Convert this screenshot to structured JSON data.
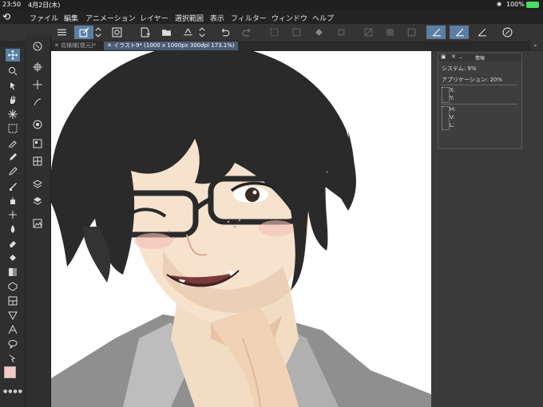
{
  "status": {
    "time": "23:50",
    "date": "4月2日(木)",
    "battery": "100%"
  },
  "menu": {
    "items": [
      "ファイル",
      "編集",
      "アニメーション",
      "レイヤー",
      "選択範囲",
      "表示",
      "フィルター",
      "ウィンドウ",
      "ヘルプ"
    ]
  },
  "tabs": [
    {
      "label": "花様様[復元]*"
    },
    {
      "label": "イラスト9* (1000 x 1000px 300dpi 173.1%)"
    }
  ],
  "info_panel": {
    "title": "情報",
    "system_label": "システム:",
    "system_value": "9%",
    "app_label": "アプリケーション:",
    "app_value": "20%",
    "x_label": "X:",
    "y_label": "Y:",
    "h_label": "H:",
    "v_label": "V:",
    "l_label": "L:"
  },
  "colors": {
    "main": "#f3c8c4",
    "sub": "#ffffff",
    "accent": "#5b7ea3",
    "hair": "#2a2a2a",
    "skin": "#f3dcc4"
  },
  "icons": [
    "menu-icon",
    "edit-icon",
    "canvas-icon",
    "new-icon",
    "open-icon",
    "save-icon",
    "undo-icon",
    "redo-icon",
    "settings-icon"
  ]
}
